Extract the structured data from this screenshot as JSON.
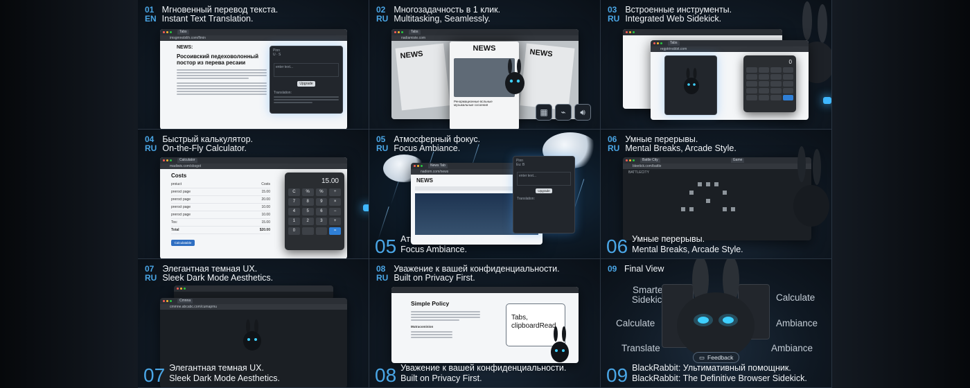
{
  "panels": [
    {
      "num": "01",
      "lang": "EN",
      "title_ru": "Мгновенный перевод текста.",
      "title_en": "Instant Text Translation."
    },
    {
      "num": "02",
      "lang": "RU",
      "title_ru": "Многозадачность в 1 клик.",
      "title_en": "Multitasking, Seamlessly."
    },
    {
      "num": "03",
      "lang": "RU",
      "title_ru": "Встроенные инструменты.",
      "title_en": "Integrated Web Sidekick."
    },
    {
      "num": "04",
      "lang": "RU",
      "title_ru": "Быстрый калькулятор.",
      "title_en": "On-the-Fly Calculator."
    },
    {
      "num": "05",
      "lang": "RU",
      "title_ru": "Атмосферный фокус.",
      "title_en": "Focus Ambiance."
    },
    {
      "num": "06",
      "lang": "RU",
      "title_ru": "Умные перерывы.",
      "title_en": "Mental Breaks, Arcade Style."
    },
    {
      "num": "07",
      "lang": "RU",
      "title_ru": "Элегантная темная UX.",
      "title_en": "Sleek Dark Mode Aesthetics."
    },
    {
      "num": "08",
      "lang": "RU",
      "title_ru": "Уважение к вашей конфиденциальности.",
      "title_en": "Built on Privacy First."
    },
    {
      "num": "09",
      "title": "Final View"
    }
  ],
  "captions": {
    "p05": {
      "num": "05",
      "ru": "Атмосферный фокус.",
      "en": "Focus Ambiance."
    },
    "p06": {
      "num": "06",
      "ru": "Умные перерывы.",
      "en": "Mental Breaks, Arcade Style."
    },
    "p07": {
      "num": "07",
      "ru": "Элегантная темная UX.",
      "en": "Sleek Dark Mode Aesthetics."
    },
    "p08": {
      "num": "08",
      "ru": "Уважение к вашей конфиденциальности.",
      "en": "Built on Privacy First."
    },
    "p09": {
      "num": "09",
      "ru": "BlackRabbit: Ультимативный помощник.",
      "en": "BlackRabbit: The Definitive Browser Sidekick."
    }
  },
  "p01": {
    "news_label": "NEWS:",
    "headline": "Росоивский педеховолонный постор из перева ресаии",
    "popup_input": "enter text...",
    "popup_button": "Upgrade",
    "popup_result": "Translation:"
  },
  "p02": {
    "news_left": "NEWS",
    "news_center": "NEWS",
    "news_right": "NEWS",
    "caption": "Ренормационные всльные музыкальные сосоения"
  },
  "p03": {
    "calc_display": "0"
  },
  "p04": {
    "title": "Costs",
    "col_item": "proiuct",
    "col_cost": "Costs",
    "rows": [
      {
        "item": "preroct page",
        "cost": "15.00"
      },
      {
        "item": "preroct page",
        "cost": "20.00"
      },
      {
        "item": "preroct page",
        "cost": "10.00"
      },
      {
        "item": "preroct page",
        "cost": "10.00"
      },
      {
        "item": "Tos:",
        "cost": "15.00"
      },
      {
        "item": "Total",
        "cost": "$20.00"
      }
    ],
    "button": "Calculatable",
    "calc_display": "15.00",
    "keys": [
      "C",
      "%",
      "%",
      "÷",
      "7",
      "8",
      "9",
      "×",
      "4",
      "5",
      "6",
      "−",
      "1",
      "2",
      "3",
      "+",
      "0",
      "",
      "",
      ""
    ]
  },
  "p05": {
    "news": "NEWS",
    "popup_input": "enter text...",
    "popup_button": "Upgrade",
    "popup_result": "Translation:"
  },
  "p06": {
    "game_title": "BATTLECITY"
  },
  "p08": {
    "title": "Simple Policy",
    "sub": "Mutracominion",
    "card": "Tabs, clipboardRead"
  },
  "p09": {
    "feature_left_1": "Smarter Sidekick",
    "feature_left_2": "Calculate",
    "feature_left_3": "Translate",
    "feature_right_1": "Calculate",
    "feature_right_2": "Ambiance",
    "feature_right_3": "Ambiance",
    "feedback": "Feedback"
  },
  "colors": {
    "accent": "#4aa6e6",
    "glow": "#3fb7ff",
    "bg": "#0f1822"
  },
  "icons": [
    "calculator-icon",
    "gamepad-icon",
    "speaker-icon",
    "feedback-icon",
    "bunny-icon"
  ]
}
